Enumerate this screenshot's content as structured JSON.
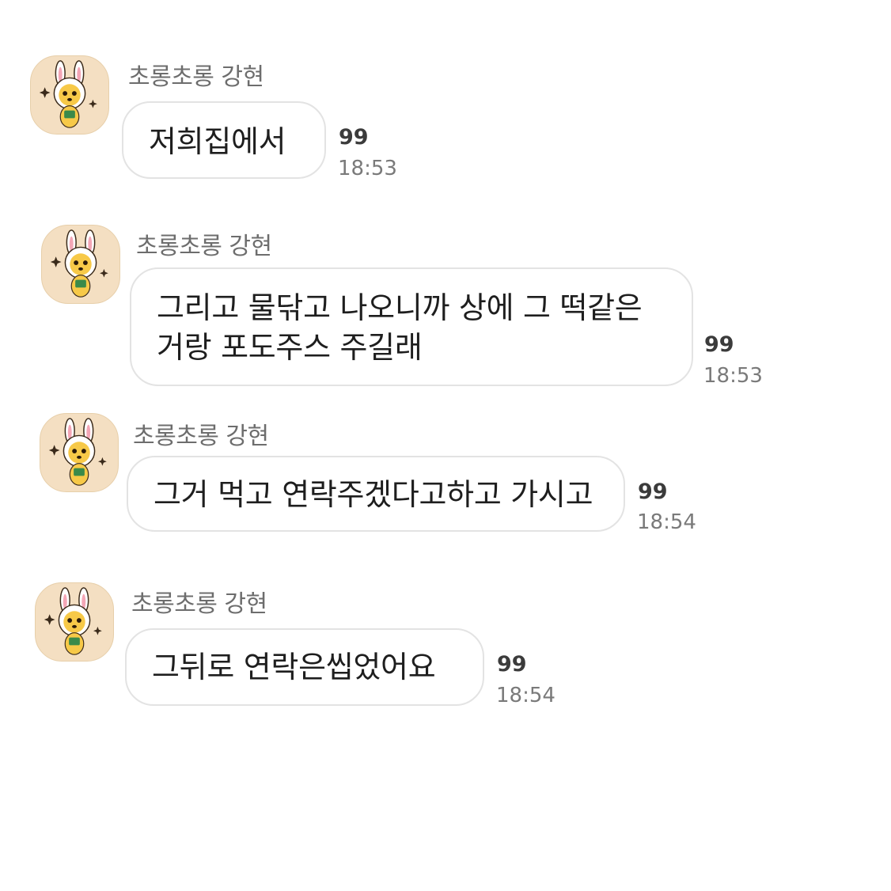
{
  "messages": [
    {
      "sender": "초롱초롱 강현",
      "lines": [
        "저희집에서"
      ],
      "unread": "99",
      "time": "18:53"
    },
    {
      "sender": "초롱초롱 강현",
      "lines": [
        "그리고 물닦고 나오니까 상에 그 떡같은",
        "거랑 포도주스 주길래"
      ],
      "unread": "99",
      "time": "18:53"
    },
    {
      "sender": "초롱초롱 강현",
      "lines": [
        "그거 먹고 연락주겠다고하고 가시고"
      ],
      "unread": "99",
      "time": "18:54"
    },
    {
      "sender": "초롱초롱 강현",
      "lines": [
        "그뒤로 연락은씹었어요"
      ],
      "unread": "99",
      "time": "18:54"
    }
  ],
  "avatar_icon": "bunny-hood-character-icon",
  "colors": {
    "background": "#ffffff",
    "avatar_bg": "#f4dfc2",
    "bubble_border": "#e3e3e3",
    "text": "#1e1e1e",
    "sender": "#6d6d6d"
  }
}
